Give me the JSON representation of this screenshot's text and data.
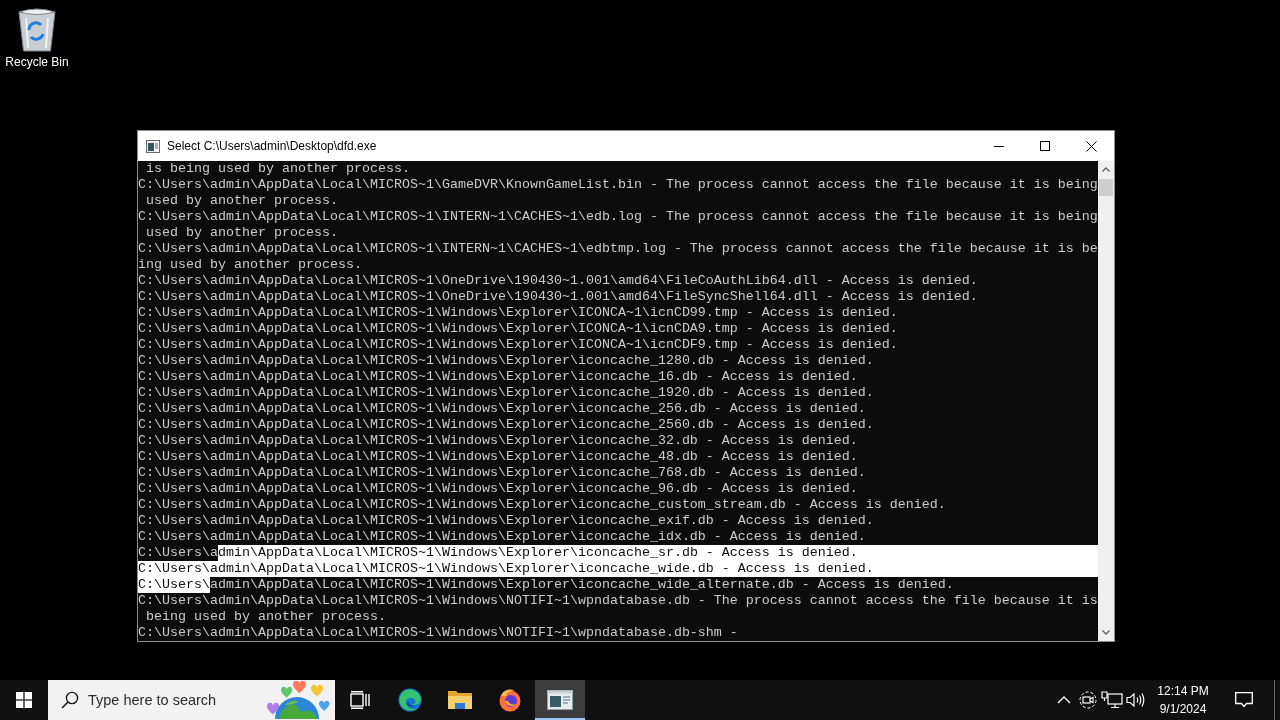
{
  "desktop": {
    "icons": [
      {
        "label": "Recycle Bin"
      }
    ]
  },
  "window": {
    "title": "Select C:\\Users\\admin\\Desktop\\dfd.exe",
    "console": {
      "lines": [
        {
          "segments": [
            {
              "text": " is being used by another process.",
              "selected": false
            }
          ]
        },
        {
          "segments": [
            {
              "text": "C:\\Users\\admin\\AppData\\Local\\MICROS~1\\GameDVR\\KnownGameList.bin - The process cannot access the file because it is being",
              "selected": false
            }
          ]
        },
        {
          "segments": [
            {
              "text": " used by another process.",
              "selected": false
            }
          ]
        },
        {
          "segments": [
            {
              "text": "C:\\Users\\admin\\AppData\\Local\\MICROS~1\\INTERN~1\\CACHES~1\\edb.log - The process cannot access the file because it is being",
              "selected": false
            }
          ]
        },
        {
          "segments": [
            {
              "text": " used by another process.",
              "selected": false
            }
          ]
        },
        {
          "segments": [
            {
              "text": "C:\\Users\\admin\\AppData\\Local\\MICROS~1\\INTERN~1\\CACHES~1\\edbtmp.log - The process cannot access the file because it is be",
              "selected": false
            }
          ]
        },
        {
          "segments": [
            {
              "text": "ing used by another process.",
              "selected": false
            }
          ]
        },
        {
          "segments": [
            {
              "text": "C:\\Users\\admin\\AppData\\Local\\MICROS~1\\OneDrive\\190430~1.001\\amd64\\FileCoAuthLib64.dll - Access is denied.",
              "selected": false
            }
          ]
        },
        {
          "segments": [
            {
              "text": "C:\\Users\\admin\\AppData\\Local\\MICROS~1\\OneDrive\\190430~1.001\\amd64\\FileSyncShell64.dll - Access is denied.",
              "selected": false
            }
          ]
        },
        {
          "segments": [
            {
              "text": "C:\\Users\\admin\\AppData\\Local\\MICROS~1\\Windows\\Explorer\\ICONCA~1\\icnCD99.tmp - Access is denied.",
              "selected": false
            }
          ]
        },
        {
          "segments": [
            {
              "text": "C:\\Users\\admin\\AppData\\Local\\MICROS~1\\Windows\\Explorer\\ICONCA~1\\icnCDA9.tmp - Access is denied.",
              "selected": false
            }
          ]
        },
        {
          "segments": [
            {
              "text": "C:\\Users\\admin\\AppData\\Local\\MICROS~1\\Windows\\Explorer\\ICONCA~1\\icnCDF9.tmp - Access is denied.",
              "selected": false
            }
          ]
        },
        {
          "segments": [
            {
              "text": "C:\\Users\\admin\\AppData\\Local\\MICROS~1\\Windows\\Explorer\\iconcache_1280.db - Access is denied.",
              "selected": false
            }
          ]
        },
        {
          "segments": [
            {
              "text": "C:\\Users\\admin\\AppData\\Local\\MICROS~1\\Windows\\Explorer\\iconcache_16.db - Access is denied.",
              "selected": false
            }
          ]
        },
        {
          "segments": [
            {
              "text": "C:\\Users\\admin\\AppData\\Local\\MICROS~1\\Windows\\Explorer\\iconcache_1920.db - Access is denied.",
              "selected": false
            }
          ]
        },
        {
          "segments": [
            {
              "text": "C:\\Users\\admin\\AppData\\Local\\MICROS~1\\Windows\\Explorer\\iconcache_256.db - Access is denied.",
              "selected": false
            }
          ]
        },
        {
          "segments": [
            {
              "text": "C:\\Users\\admin\\AppData\\Local\\MICROS~1\\Windows\\Explorer\\iconcache_2560.db - Access is denied.",
              "selected": false
            }
          ]
        },
        {
          "segments": [
            {
              "text": "C:\\Users\\admin\\AppData\\Local\\MICROS~1\\Windows\\Explorer\\iconcache_32.db - Access is denied.",
              "selected": false
            }
          ]
        },
        {
          "segments": [
            {
              "text": "C:\\Users\\admin\\AppData\\Local\\MICROS~1\\Windows\\Explorer\\iconcache_48.db - Access is denied.",
              "selected": false
            }
          ]
        },
        {
          "segments": [
            {
              "text": "C:\\Users\\admin\\AppData\\Local\\MICROS~1\\Windows\\Explorer\\iconcache_768.db - Access is denied.",
              "selected": false
            }
          ]
        },
        {
          "segments": [
            {
              "text": "C:\\Users\\admin\\AppData\\Local\\MICROS~1\\Windows\\Explorer\\iconcache_96.db - Access is denied.",
              "selected": false
            }
          ]
        },
        {
          "segments": [
            {
              "text": "C:\\Users\\admin\\AppData\\Local\\MICROS~1\\Windows\\Explorer\\iconcache_custom_stream.db - Access is denied.",
              "selected": false
            }
          ]
        },
        {
          "segments": [
            {
              "text": "C:\\Users\\admin\\AppData\\Local\\MICROS~1\\Windows\\Explorer\\iconcache_exif.db - Access is denied.",
              "selected": false
            }
          ]
        },
        {
          "segments": [
            {
              "text": "C:\\Users\\admin\\AppData\\Local\\MICROS~1\\Windows\\Explorer\\iconcache_idx.db - Access is denied.",
              "selected": false
            }
          ]
        },
        {
          "segments": [
            {
              "text": "C:\\Users\\a",
              "selected": false
            },
            {
              "text": "dmin\\AppData\\Local\\MICROS~1\\Windows\\Explorer\\iconcache_sr.db - Access is denied.",
              "selected": true
            }
          ]
        },
        {
          "segments": [
            {
              "text": "C:\\Users\\admin\\AppData\\Local\\MICROS~1\\Windows\\Explorer\\iconcache_wide.db - Access is denied.",
              "selected": true
            }
          ]
        },
        {
          "segments": [
            {
              "text": "C:\\Users\\",
              "selected": true
            },
            {
              "text": "admin\\AppData\\Local\\MICROS~1\\Windows\\Explorer\\iconcache_wide_alternate.db - Access is denied.",
              "selected": false
            }
          ]
        },
        {
          "segments": [
            {
              "text": "C:\\Users\\admin\\AppData\\Local\\MICROS~1\\Windows\\NOTIFI~1\\wpndatabase.db - The process cannot access the file because it is",
              "selected": false
            }
          ]
        },
        {
          "segments": [
            {
              "text": " being used by another process.",
              "selected": false
            }
          ]
        },
        {
          "segments": [
            {
              "text": "C:\\Users\\admin\\AppData\\Local\\MICROS~1\\Windows\\NOTIFI~1\\wpndatabase.db-shm -",
              "selected": false
            }
          ]
        }
      ]
    }
  },
  "taskbar": {
    "search": {
      "placeholder": "Type here to search"
    },
    "apps": [
      {
        "kind": "edge",
        "selected": false
      },
      {
        "kind": "explorer",
        "selected": false
      },
      {
        "kind": "firefox",
        "selected": false
      },
      {
        "kind": "console",
        "selected": true
      }
    ],
    "clock": {
      "time": "12:14 PM",
      "date": "9/1/2024"
    }
  }
}
